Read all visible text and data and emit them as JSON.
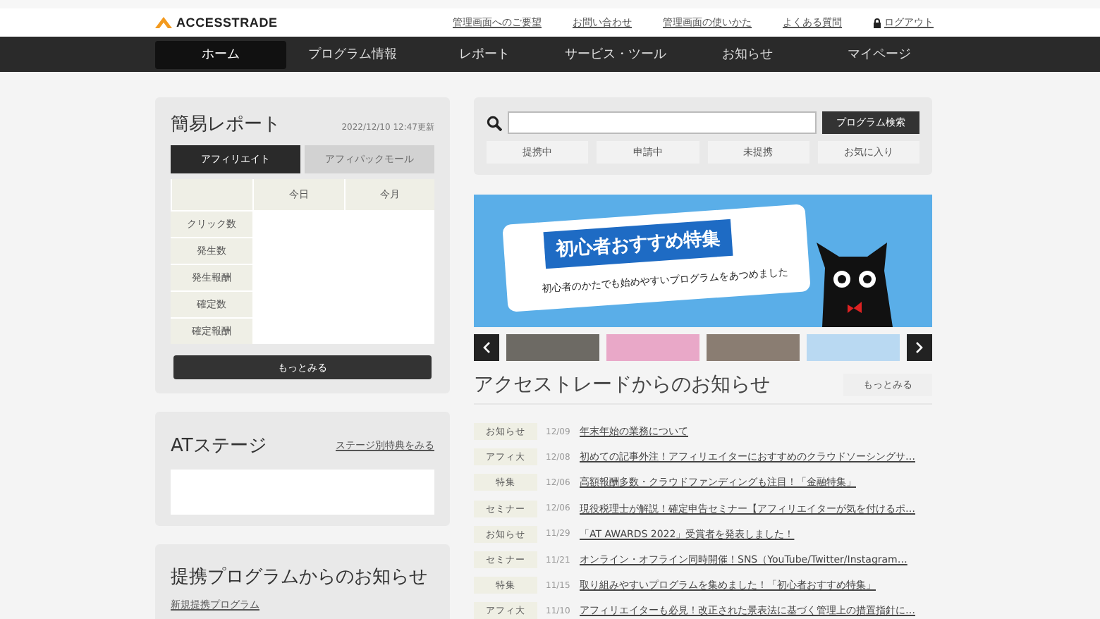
{
  "header": {
    "logo": "ACCESSTRADE",
    "links": [
      {
        "label": "管理画面へのご要望",
        "kind": "link"
      },
      {
        "label": "お問い合わせ",
        "kind": "link"
      },
      {
        "label": "管理画面の使いかた",
        "kind": "link"
      },
      {
        "label": "よくある質問",
        "kind": "link"
      },
      {
        "label": "ログアウト",
        "kind": "lock"
      }
    ]
  },
  "nav": [
    {
      "label": "ホーム",
      "selected": true
    },
    {
      "label": "プログラム情報",
      "selected": false
    },
    {
      "label": "レポート",
      "selected": false
    },
    {
      "label": "サービス・ツール",
      "selected": false
    },
    {
      "label": "お知らせ",
      "selected": false
    },
    {
      "label": "マイページ",
      "selected": false
    }
  ],
  "report": {
    "title": "簡易レポート",
    "updated": "2022/12/10 12:47更新",
    "tabs": [
      {
        "label": "アフィリエイト",
        "selected": true
      },
      {
        "label": "アフィパックモール",
        "selected": false
      }
    ],
    "columns": [
      "今日",
      "今月"
    ],
    "rows": [
      "クリック数",
      "発生数",
      "発生報酬",
      "確定数",
      "確定報酬"
    ],
    "more": "もっとみる"
  },
  "stage": {
    "title": "ATステージ",
    "link": "ステージ別特典をみる"
  },
  "partner_news": {
    "title": "提携プログラムからのお知らせ",
    "links": [
      "新規提携プログラム"
    ]
  },
  "search": {
    "button": "プログラム検索",
    "filters": [
      "提携中",
      "申請中",
      "未提携",
      "お気に入り"
    ]
  },
  "banner": {
    "title": "初心者おすすめ特集",
    "subtitle": "初心者のかたでも始めやすいプログラムをあつめました"
  },
  "news": {
    "title": "アクセストレードからのお知らせ",
    "more": "もっとみる",
    "items": [
      {
        "tag": "お知らせ",
        "date": "12/09",
        "title": "年末年始の業務について"
      },
      {
        "tag": "アフィ大",
        "date": "12/08",
        "title": "初めての記事外注！アフィリエイターにおすすめのクラウドソーシングサ…"
      },
      {
        "tag": "特集",
        "date": "12/06",
        "title": "高額報酬多数・クラウドファンディングも注目！「金融特集」"
      },
      {
        "tag": "セミナー",
        "date": "12/06",
        "title": "現役税理士が解説！確定申告セミナー【アフィリエイターが気を付けるポ…"
      },
      {
        "tag": "お知らせ",
        "date": "11/29",
        "title": "「AT AWARDS 2022」受賞者を発表しました！"
      },
      {
        "tag": "セミナー",
        "date": "11/21",
        "title": "オンライン・オフライン同時開催！SNS（YouTube/Twitter/Instagram…"
      },
      {
        "tag": "特集",
        "date": "11/15",
        "title": "取り組みやすいプログラムを集めました！「初心者おすすめ特集」"
      },
      {
        "tag": "アフィ大",
        "date": "11/10",
        "title": "アフィリエイターも必見！改正された景表法に基づく管理上の措置指針に…"
      }
    ]
  }
}
